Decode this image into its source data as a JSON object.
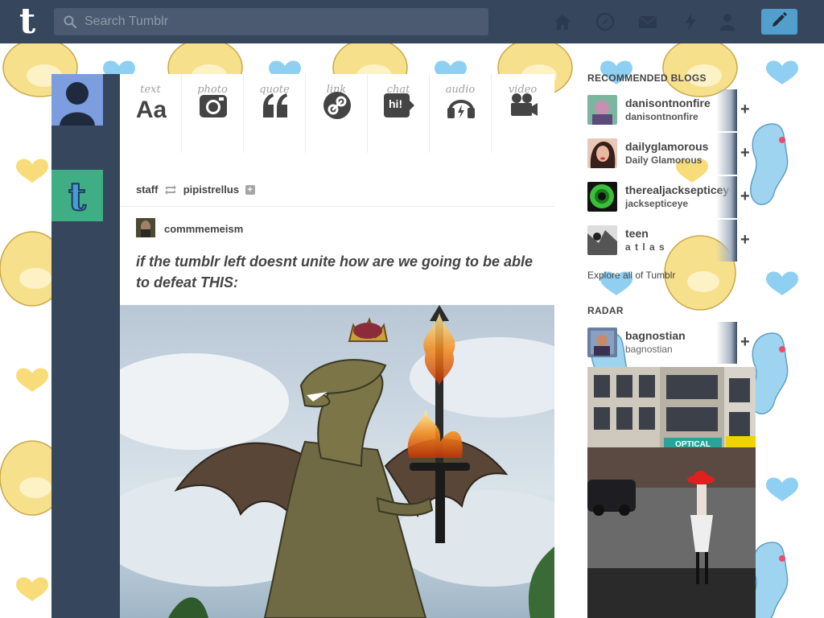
{
  "header": {
    "logo": "t",
    "search_placeholder": "Search Tumblr",
    "nav_icons": [
      "home-icon",
      "compass-icon",
      "mail-icon",
      "lightning-icon",
      "account-icon"
    ],
    "compose_icon": "pencil-icon",
    "accent": "#529ecc",
    "bar_color": "#36465d"
  },
  "post_types": [
    {
      "label": "text",
      "icon": "text-icon"
    },
    {
      "label": "photo",
      "icon": "camera-icon"
    },
    {
      "label": "quote",
      "icon": "quote-icon"
    },
    {
      "label": "link",
      "icon": "link-icon"
    },
    {
      "label": "chat",
      "icon": "chat-icon",
      "glyph": "hi!"
    },
    {
      "label": "audio",
      "icon": "headphones-icon"
    },
    {
      "label": "video",
      "icon": "video-camera-icon"
    }
  ],
  "post": {
    "reblogger": "staff",
    "reblogged_from": "pipistrellus",
    "source": "commmemeism",
    "text": "if the tumblr left doesnt unite how are we going to be able to defeat THIS:"
  },
  "sidebar": {
    "recommended_title": "RECOMMENDED BLOGS",
    "recommended": [
      {
        "name": "danisontnonfire",
        "title": "danisontnonfire"
      },
      {
        "name": "dailyglamorous",
        "title": "Daily Glamorous"
      },
      {
        "name": "therealjacksepticeye",
        "title": "jacksepticeye"
      },
      {
        "name": "teen",
        "title": "a t l a s"
      }
    ],
    "explore": "Explore all of Tumblr",
    "radar_title": "RADAR",
    "radar": {
      "name": "bagnostian",
      "title": "bagnostian"
    },
    "radar_image_text": "OPTICAL"
  }
}
